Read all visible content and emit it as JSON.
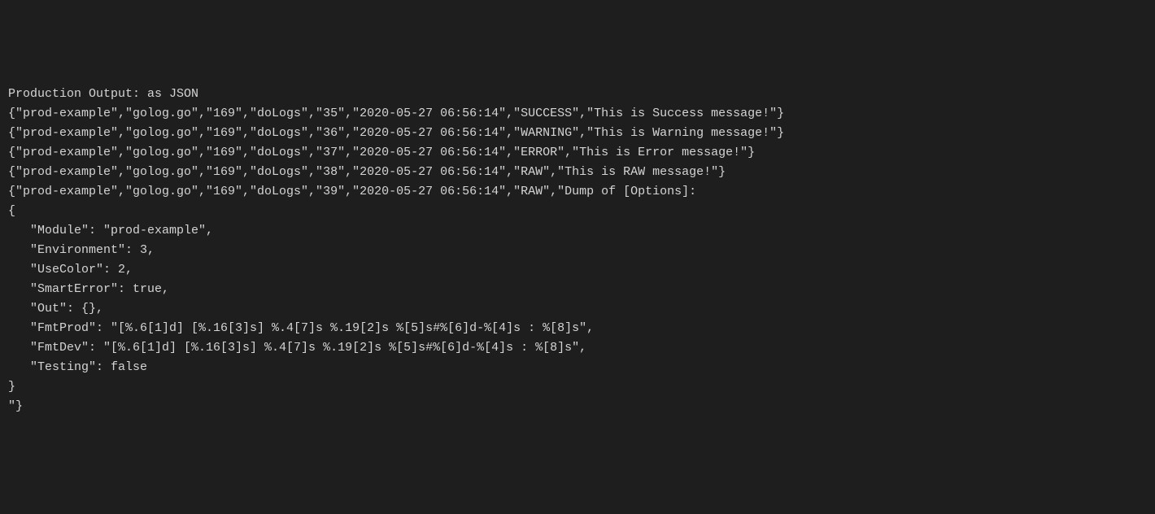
{
  "header": "Production Output: as JSON",
  "logLines": [
    "{\"prod-example\",\"golog.go\",\"169\",\"doLogs\",\"35\",\"2020-05-27 06:56:14\",\"SUCCESS\",\"This is Success message!\"}",
    "{\"prod-example\",\"golog.go\",\"169\",\"doLogs\",\"36\",\"2020-05-27 06:56:14\",\"WARNING\",\"This is Warning message!\"}",
    "{\"prod-example\",\"golog.go\",\"169\",\"doLogs\",\"37\",\"2020-05-27 06:56:14\",\"ERROR\",\"This is Error message!\"}",
    "{\"prod-example\",\"golog.go\",\"169\",\"doLogs\",\"38\",\"2020-05-27 06:56:14\",\"RAW\",\"This is RAW message!\"}",
    "{\"prod-example\",\"golog.go\",\"169\",\"doLogs\",\"39\",\"2020-05-27 06:56:14\",\"RAW\",\"Dump of [Options]:",
    "{",
    "   \"Module\": \"prod-example\",",
    "   \"Environment\": 3,",
    "   \"UseColor\": 2,",
    "   \"SmartError\": true,",
    "   \"Out\": {},",
    "   \"FmtProd\": \"[%.6[1]d] [%.16[3]s] %.4[7]s %.19[2]s %[5]s#%[6]d-%[4]s : %[8]s\",",
    "   \"FmtDev\": \"[%.6[1]d] [%.16[3]s] %.4[7]s %.19[2]s %[5]s#%[6]d-%[4]s : %[8]s\",",
    "   \"Testing\": false",
    "}",
    "\"}"
  ]
}
